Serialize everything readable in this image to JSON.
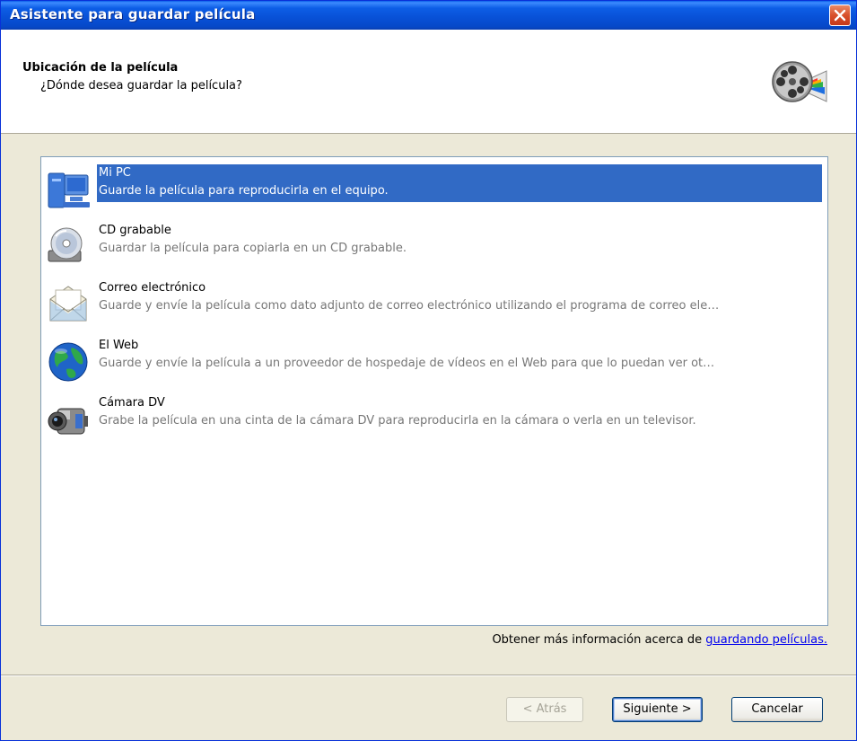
{
  "window": {
    "title": "Asistente para guardar película"
  },
  "header": {
    "title": "Ubicación de la película",
    "subtitle": "¿Dónde desea guardar la película?",
    "icon": "movie-film-reel-icon"
  },
  "locations": [
    {
      "name": "Mi PC",
      "description": "Guarde la película para reproducirla en el equipo.",
      "icon": "computer-icon",
      "selected": true
    },
    {
      "name": "CD grabable",
      "description": "Guardar la película para copiarla en un CD grabable.",
      "icon": "cd-drive-icon",
      "selected": false
    },
    {
      "name": "Correo electrónico",
      "description": "Guarde y envíe la película como dato adjunto de correo electrónico utilizando el programa de correo ele…",
      "icon": "email-envelope-icon",
      "selected": false
    },
    {
      "name": "El Web",
      "description": "Guarde y envíe la película a un proveedor de hospedaje de vídeos en el Web para que lo puedan ver ot…",
      "icon": "globe-icon",
      "selected": false
    },
    {
      "name": "Cámara DV",
      "description": "Grabe la película en una cinta de la cámara DV para reproducirla en la cámara o verla en un televisor.",
      "icon": "camcorder-icon",
      "selected": false
    }
  ],
  "more_info": {
    "prefix": "Obtener más información acerca de ",
    "link": "guardando películas."
  },
  "buttons": {
    "back": "< Atrás",
    "next": "Siguiente >",
    "cancel": "Cancelar"
  },
  "colors": {
    "title_bar": "#0850d6",
    "selection": "#316ac5",
    "link": "#0000ee",
    "dialog_bg": "#ece9d8"
  }
}
